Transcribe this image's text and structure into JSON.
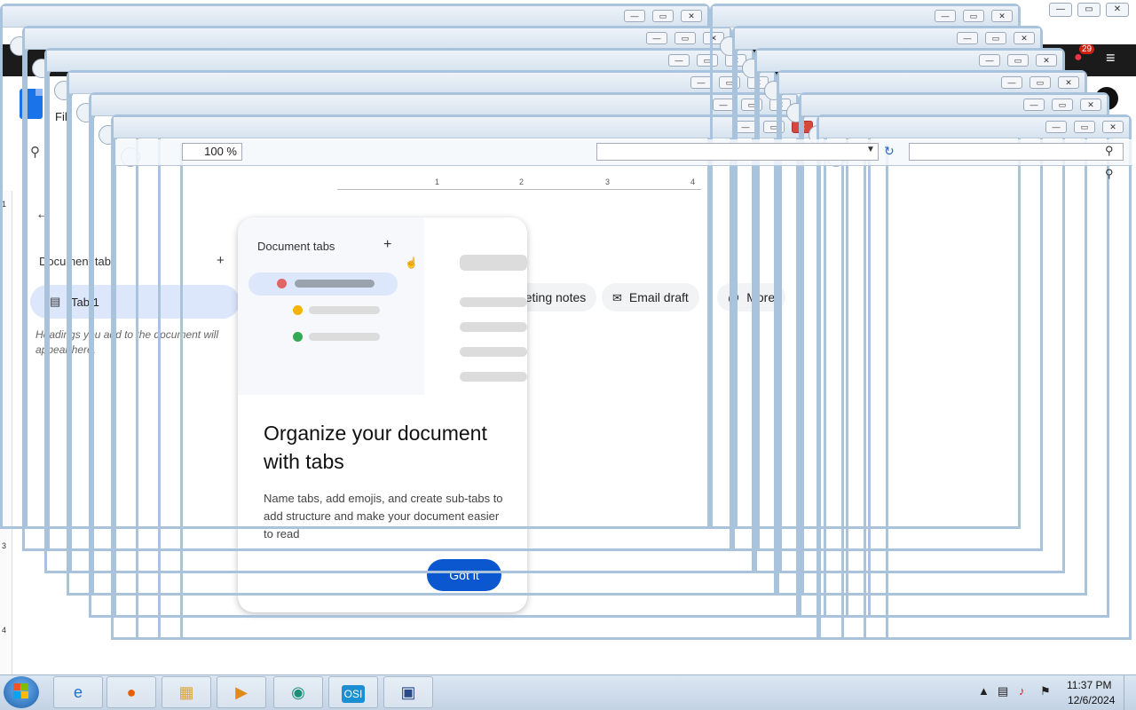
{
  "docs": {
    "file_menu": "Fil",
    "ruler_v_labels": [
      "1",
      "3",
      "4"
    ],
    "ruler_h_labels": [
      "1",
      "2",
      "3",
      "4"
    ],
    "outline": {
      "title": "Document tabs",
      "plus": "+",
      "tab_label": "Tab 1",
      "hint": "Headings you add to the document will appear here."
    },
    "chips": [
      {
        "icon": "notes-icon",
        "label": "Meeting notes"
      },
      {
        "icon": "mail-icon",
        "label": "Email draft"
      },
      {
        "icon": "at-icon",
        "label": "More"
      }
    ],
    "notification_count": "29"
  },
  "popover": {
    "mini_title": "Document tabs",
    "mini_plus": "+",
    "title": "Organize your document with tabs",
    "body": "Name tabs, add emojis, and create sub-tabs to add structure and make your document easier to read",
    "button": "Got it",
    "dot_colors": [
      "#e06666",
      "#f4b400",
      "#34a853"
    ]
  },
  "browser": {
    "zoom": "100 %",
    "window_controls": [
      "—",
      "▭",
      "✕"
    ]
  },
  "taskbar": {
    "apps": [
      "internet-explorer",
      "firefox",
      "file-explorer",
      "media-player",
      "app-teal",
      "osi",
      "virtualbox"
    ],
    "osi_label": "OSI",
    "time": "11:37 PM",
    "date": "12/6/2024"
  },
  "colors": {
    "accent": "#0b57d0",
    "window_border": "#a9c3dc",
    "close_red": "#d9473b"
  }
}
